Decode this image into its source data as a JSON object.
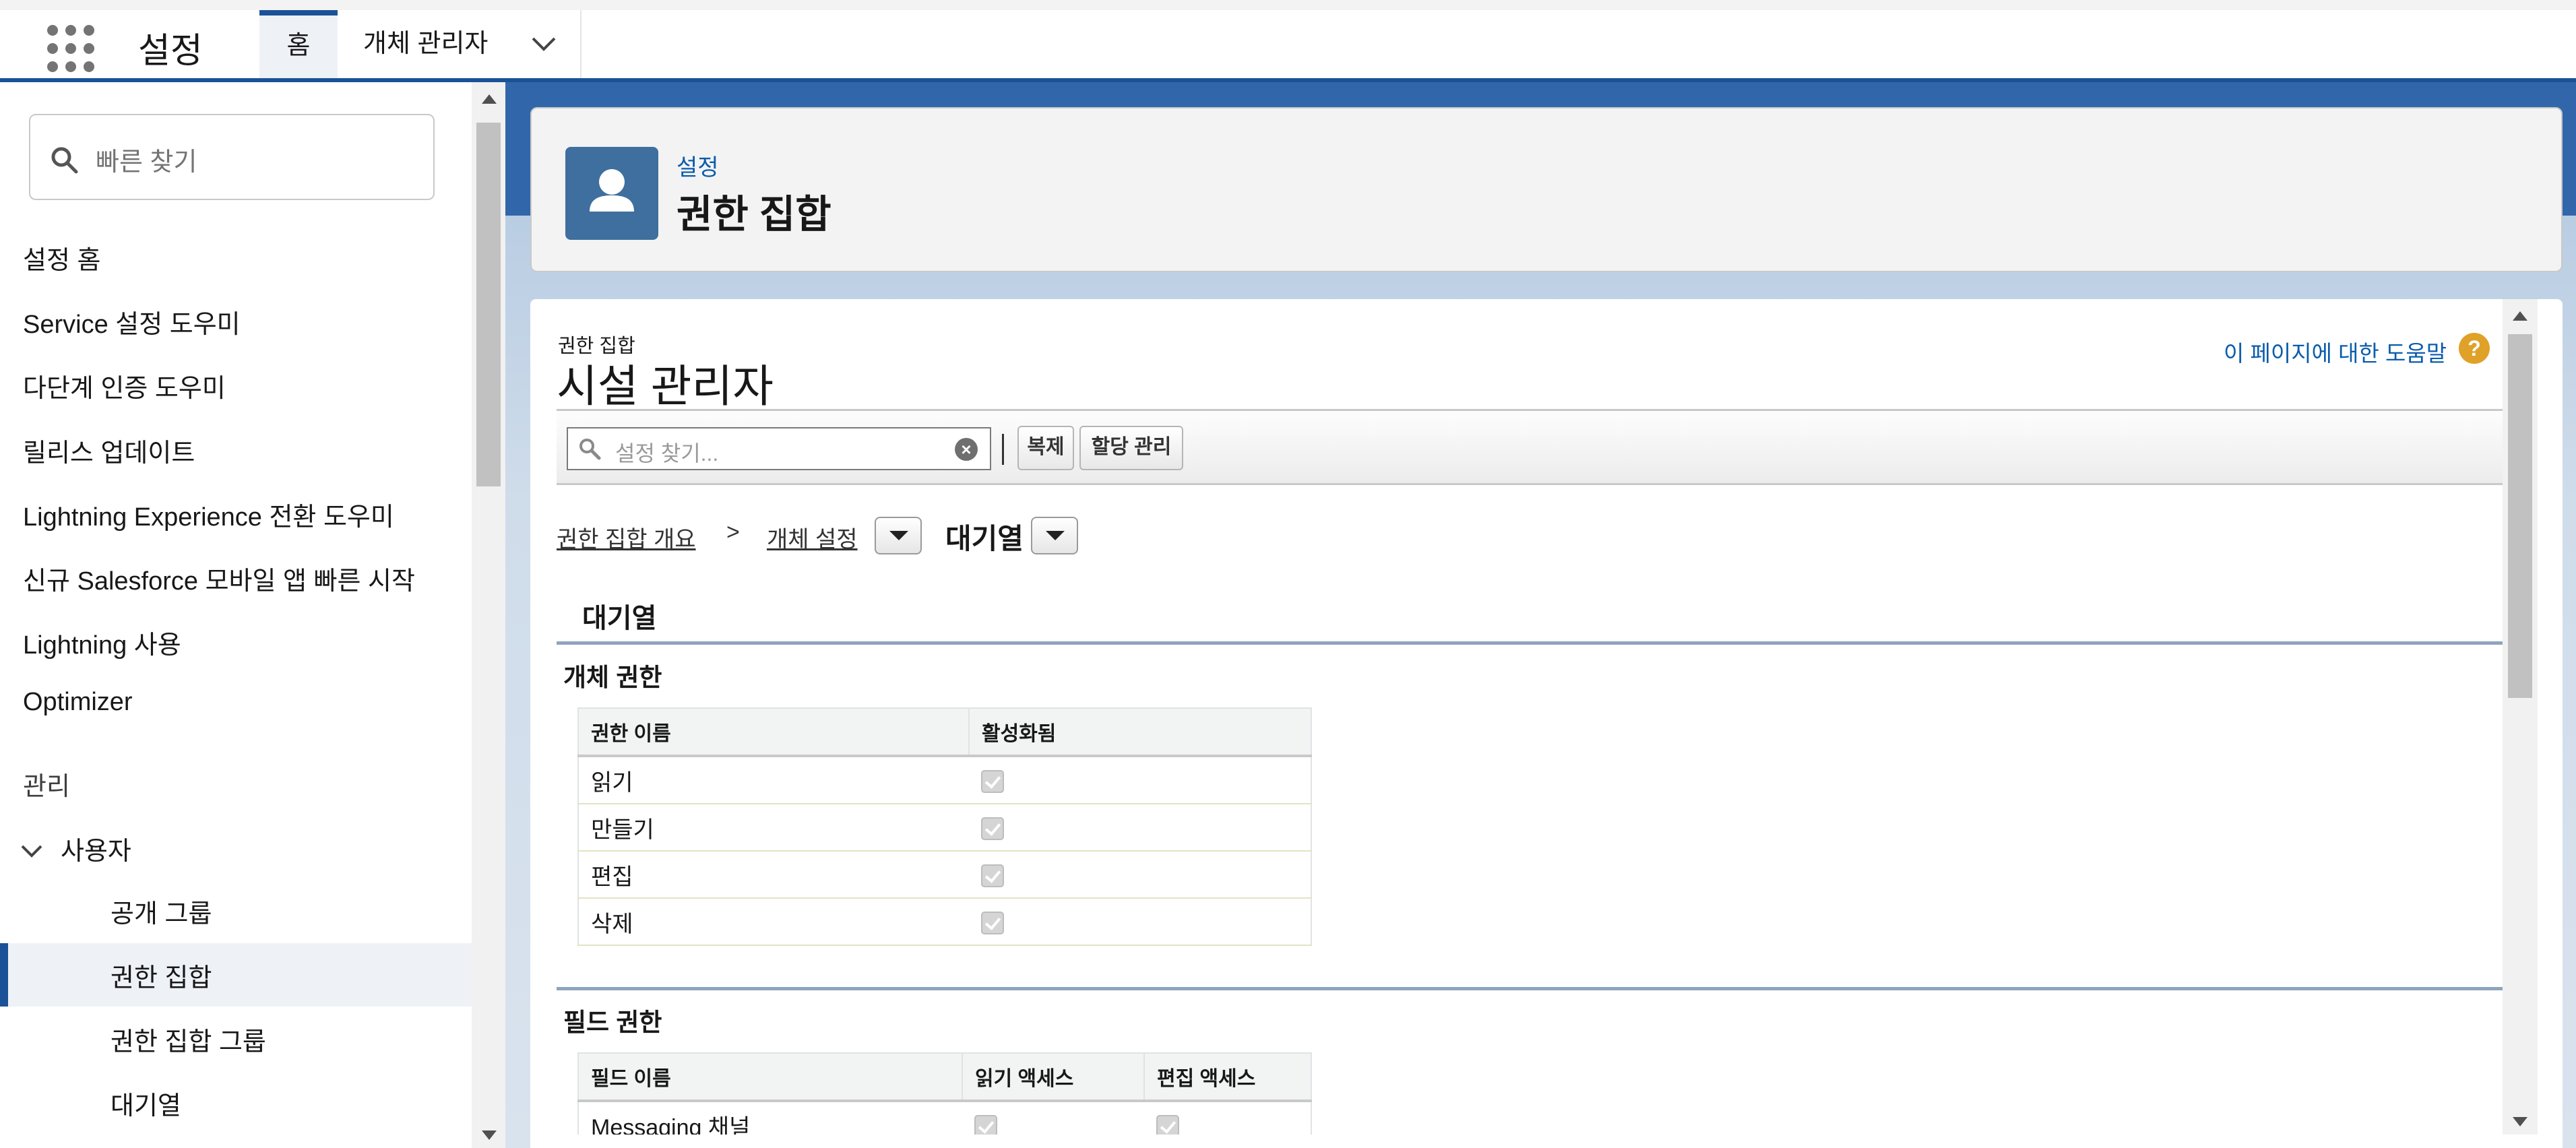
{
  "app": {
    "title": "설정"
  },
  "tabs": {
    "home": "홈",
    "object_manager": "개체 관리자"
  },
  "sidebar": {
    "search_placeholder": "빠른 찾기",
    "items": [
      "설정 홈",
      "Service 설정 도우미",
      "다단계 인증 도우미",
      "릴리스 업데이트",
      "Lightning Experience 전환 도우미",
      "신규 Salesforce 모바일 앱 빠른 시작",
      "Lightning 사용",
      "Optimizer"
    ],
    "section_admin": "관리",
    "group_users": "사용자",
    "sub_items": [
      "공개 그룹",
      "권한 집합",
      "권한 집합 그룹",
      "대기열"
    ],
    "selected_item": "권한 집합"
  },
  "header": {
    "breadcrumb": "설정",
    "title": "권한 집합"
  },
  "content": {
    "label": "권한 집합",
    "name": "시설 관리자",
    "help_link": "이 페이지에 대한 도움말",
    "toolbar": {
      "search_placeholder": "설정 찾기...",
      "clone_button": "복제",
      "manage_assignments_button": "할당 관리"
    },
    "breadcrumb": {
      "overview": "권한 집합 개요",
      "separator": ">",
      "object_settings": "개체 설정",
      "current": "대기열"
    },
    "object_heading": "대기열",
    "object_permissions": {
      "title": "개체 권한",
      "columns": [
        "권한 이름",
        "활성화됨"
      ],
      "rows": [
        {
          "name": "읽기",
          "enabled": true
        },
        {
          "name": "만들기",
          "enabled": true
        },
        {
          "name": "편집",
          "enabled": true
        },
        {
          "name": "삭제",
          "enabled": true
        }
      ]
    },
    "field_permissions": {
      "title": "필드 권한",
      "columns": [
        "필드 이름",
        "읽기 액세스",
        "편집 액세스"
      ],
      "rows": [
        {
          "name": "Messaging 채널",
          "read": true,
          "edit": true
        }
      ]
    }
  },
  "colors": {
    "brand": "#1b5297",
    "link": "#0b5cab",
    "header_icon": "#3e6f9e",
    "help_icon": "#e0a128"
  },
  "icons": [
    "app-launcher-icon",
    "chevron-down-icon",
    "search-icon",
    "user-icon",
    "help-icon",
    "clear-icon"
  ]
}
